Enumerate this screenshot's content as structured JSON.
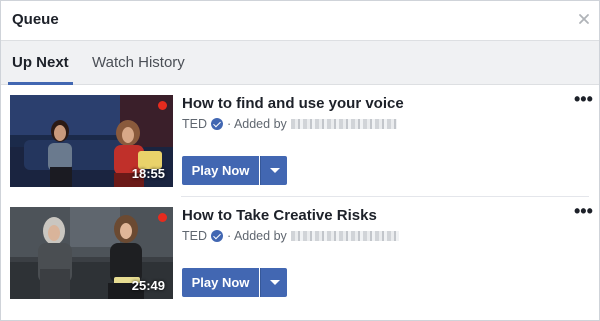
{
  "panel": {
    "title": "Queue",
    "close_icon": "close-icon"
  },
  "tabs": [
    {
      "label": "Up Next",
      "active": true
    },
    {
      "label": "Watch History",
      "active": false
    }
  ],
  "videos": [
    {
      "title": "How to find and use your voice",
      "channel": "TED",
      "added_by_prefix": "· Added by",
      "duration": "18:55",
      "play_label": "Play Now",
      "more_icon": "more-options-icon",
      "dropdown_icon": "caret-down-icon"
    },
    {
      "title": "How to Take Creative Risks",
      "channel": "TED",
      "added_by_prefix": "· Added by",
      "duration": "25:49",
      "play_label": "Play Now",
      "more_icon": "more-options-icon",
      "dropdown_icon": "caret-down-icon"
    }
  ],
  "colors": {
    "accent": "#4267b2",
    "ted_red": "#e62b1e"
  }
}
